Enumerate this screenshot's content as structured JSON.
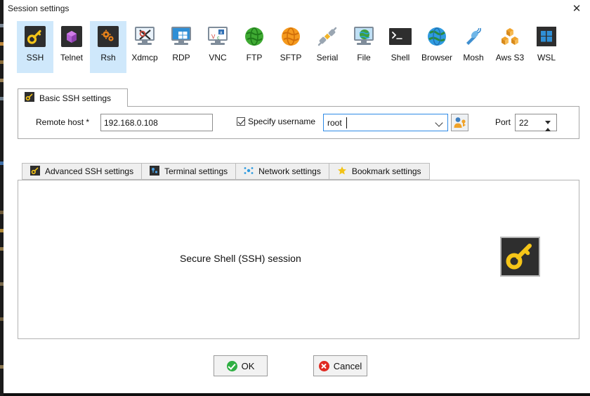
{
  "window": {
    "title": "Session settings",
    "close_label": "✕"
  },
  "session_types": [
    {
      "label": "SSH",
      "icon": "ssh-key-icon",
      "selected": true
    },
    {
      "label": "Telnet",
      "icon": "telnet-icon",
      "selected": false
    },
    {
      "label": "Rsh",
      "icon": "rsh-gears-icon",
      "selected": true
    },
    {
      "label": "Xdmcp",
      "icon": "xdmcp-monitor-icon",
      "selected": false
    },
    {
      "label": "RDP",
      "icon": "rdp-monitor-icon",
      "selected": false
    },
    {
      "label": "VNC",
      "icon": "vnc-monitor-icon",
      "selected": false
    },
    {
      "label": "FTP",
      "icon": "ftp-green-globe-icon",
      "selected": false
    },
    {
      "label": "SFTP",
      "icon": "sftp-orange-globe-icon",
      "selected": false
    },
    {
      "label": "Serial",
      "icon": "serial-plug-icon",
      "selected": false
    },
    {
      "label": "File",
      "icon": "file-monitor-globe-icon",
      "selected": false
    },
    {
      "label": "Shell",
      "icon": "shell-terminal-icon",
      "selected": false
    },
    {
      "label": "Browser",
      "icon": "browser-globe-icon",
      "selected": false
    },
    {
      "label": "Mosh",
      "icon": "mosh-satellite-icon",
      "selected": false
    },
    {
      "label": "Aws S3",
      "icon": "aws-s3-cubes-icon",
      "selected": false
    },
    {
      "label": "WSL",
      "icon": "wsl-windows-icon",
      "selected": false
    }
  ],
  "basic_settings": {
    "tab_label": "Basic SSH settings",
    "tab_icon": "ssh-key-icon",
    "remote_host_label": "Remote host *",
    "remote_host_value": "192.168.0.108",
    "remote_host_placeholder": "",
    "specify_username_label": "Specify username",
    "specify_username_checked": true,
    "username_value": "root",
    "username_button_icon": "user-key-icon",
    "port_label": "Port",
    "port_value": "22"
  },
  "sub_tabs": [
    {
      "label": "Advanced SSH settings",
      "icon": "ssh-key-icon",
      "active": false
    },
    {
      "label": "Terminal settings",
      "icon": "terminal-icon",
      "active": false
    },
    {
      "label": "Network settings",
      "icon": "network-dots-icon",
      "active": false
    },
    {
      "label": "Bookmark settings",
      "icon": "star-icon",
      "active": false
    }
  ],
  "main_panel": {
    "description": "Secure Shell (SSH) session",
    "badge_icon": "ssh-key-icon"
  },
  "footer": {
    "ok_label": "OK",
    "cancel_label": "Cancel"
  },
  "colors": {
    "selection": "#cfe8fb",
    "focus_border": "#2e8ae6",
    "key_yellow": "#f5c518",
    "ok_green": "#2eaf42",
    "cancel_red": "#e02a22",
    "dark_icon_bg": "#2e2e2e"
  }
}
